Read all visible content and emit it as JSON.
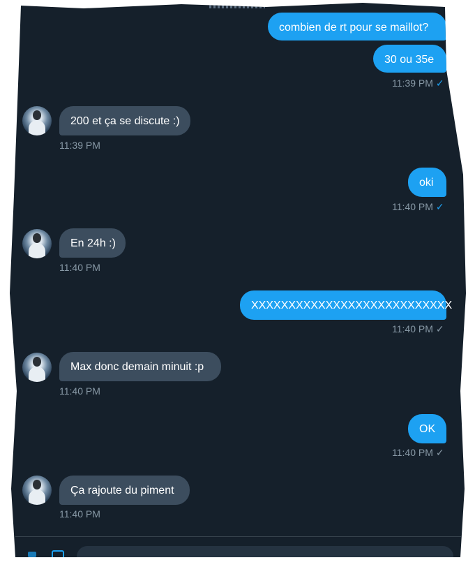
{
  "messages": [
    {
      "dir": "out",
      "text": "combien de rt pour se maillot?"
    },
    {
      "dir": "out",
      "text": "30 ou 35e",
      "time": "11:39 PM",
      "status": "read"
    },
    {
      "dir": "in",
      "text": "200 et ça se discute :)",
      "time": "11:39 PM"
    },
    {
      "dir": "out",
      "text": "oki",
      "time": "11:40 PM",
      "status": "read"
    },
    {
      "dir": "in",
      "text": "En 24h :)",
      "time": "11:40 PM"
    },
    {
      "dir": "out",
      "text": "XXXXXXXXXXXXXXXXXXXXXXXXXXX",
      "time": "11:40 PM",
      "status": "sent"
    },
    {
      "dir": "in",
      "text": "Max donc demain minuit :p",
      "time": "11:40 PM"
    },
    {
      "dir": "out",
      "text": "OK",
      "time": "11:40 PM",
      "status": "sent"
    },
    {
      "dir": "in",
      "text": "Ça rajoute du piment",
      "time": "11:40 PM"
    }
  ],
  "icons": {
    "check": "✓"
  },
  "colors": {
    "background": "#15202b",
    "outgoing_bubble": "#1da1f2",
    "incoming_bubble": "#3c4d5e",
    "timestamp": "#8899a6"
  }
}
